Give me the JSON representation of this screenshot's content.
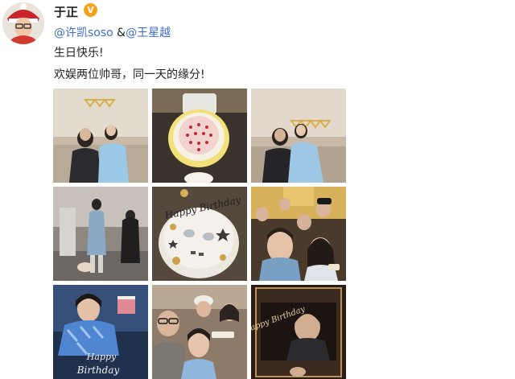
{
  "post": {
    "author": "于正",
    "verified_icon": "verified-badge-icon",
    "mentions": [
      "@许凯soso",
      "@王星越"
    ],
    "mention_separator": " &",
    "lines": [
      "生日快乐!",
      "欢娱两位帅哥，同一天的缘分!"
    ]
  },
  "photos": [
    {
      "name": "photo-1",
      "desc": "two men on sofa"
    },
    {
      "name": "photo-2",
      "desc": "strawberry cake"
    },
    {
      "name": "photo-3",
      "desc": "two men on sofa"
    },
    {
      "name": "photo-4",
      "desc": "room party"
    },
    {
      "name": "photo-5",
      "desc": "happy birthday cake"
    },
    {
      "name": "photo-6",
      "desc": "group selfie"
    },
    {
      "name": "photo-7",
      "desc": "birthday portrait"
    },
    {
      "name": "photo-8",
      "desc": "group selfie"
    },
    {
      "name": "photo-9",
      "desc": "birthday card"
    }
  ],
  "captions": {
    "cake_topper": "Happy Birthday",
    "card_happy": "Happy",
    "card_birthday": "Birthday",
    "banner": "Happy Birthday"
  },
  "colors": {
    "mention": "#3f6ec4",
    "badge": "#f7a21b",
    "text": "#222222"
  }
}
